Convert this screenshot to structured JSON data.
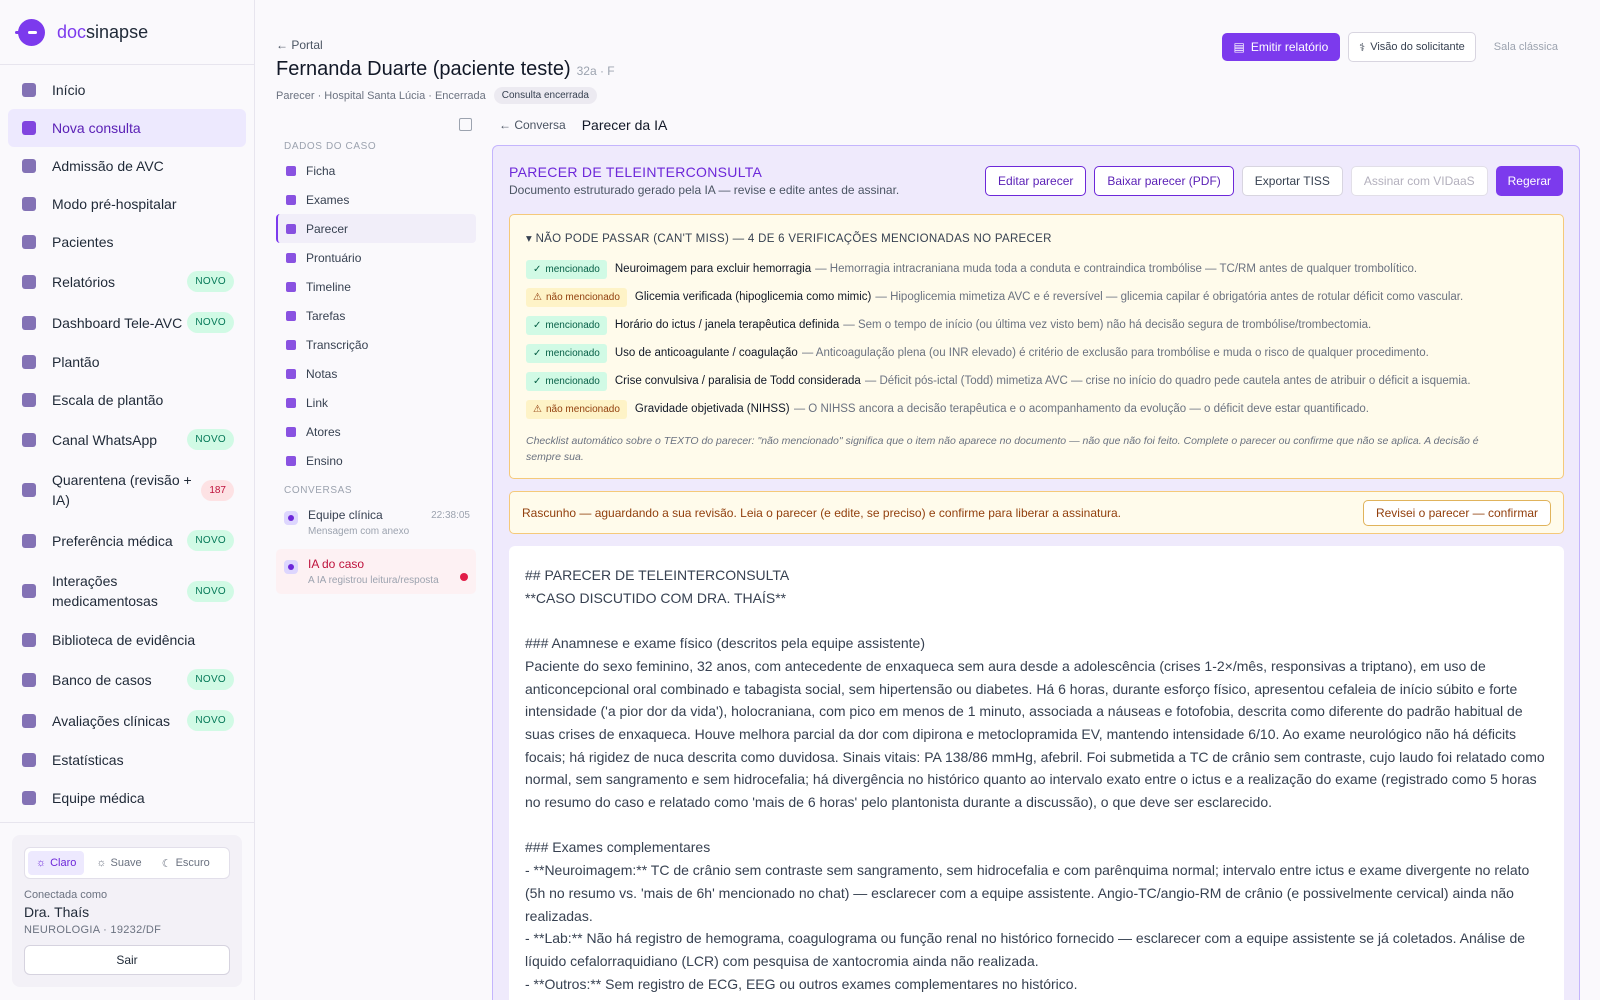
{
  "brand": {
    "prefix": "doc",
    "suffix": "sinapse"
  },
  "nav": [
    {
      "label": "Início",
      "icon": "home-icon"
    },
    {
      "label": "Nova consulta",
      "icon": "plus-icon",
      "active": true
    },
    {
      "label": "Admissão de AVC",
      "icon": "lock-icon"
    },
    {
      "label": "Modo pré-hospitalar",
      "icon": "ambulance-icon"
    },
    {
      "label": "Pacientes",
      "icon": "users-icon"
    },
    {
      "label": "Relatórios",
      "icon": "report-icon",
      "badge": "NOVO"
    },
    {
      "label": "Dashboard Tele-AVC",
      "icon": "chart-icon",
      "badge": "NOVO"
    },
    {
      "label": "Plantão",
      "icon": "shield-icon"
    },
    {
      "label": "Escala de plantão",
      "icon": "calendar-icon"
    },
    {
      "label": "Canal WhatsApp",
      "icon": "whatsapp-icon",
      "badge": "NOVO"
    },
    {
      "label": "Quarentena (revisão + IA)",
      "icon": "quarantine-icon",
      "count": "187"
    },
    {
      "label": "Preferência médica",
      "icon": "preference-icon",
      "badge": "NOVO"
    },
    {
      "label": "Interações medicamentosas",
      "icon": "pill-icon",
      "badge": "NOVO"
    },
    {
      "label": "Biblioteca de evidência",
      "icon": "book-icon"
    },
    {
      "label": "Banco de casos",
      "icon": "graduation-icon",
      "badge": "NOVO"
    },
    {
      "label": "Avaliações clínicas",
      "icon": "clipboard-icon",
      "badge": "NOVO"
    },
    {
      "label": "Estatísticas",
      "icon": "stats-icon"
    },
    {
      "label": "Equipe médica",
      "icon": "team-icon"
    }
  ],
  "theme": {
    "light": "Claro",
    "soft": "Suave",
    "dark": "Escuro"
  },
  "profile": {
    "connected_label": "Conectada como",
    "name": "Dra. Thaís",
    "role": "NEUROLOGIA · 19232/DF",
    "logout": "Sair"
  },
  "header": {
    "back": "← Portal",
    "patient_name": "Fernanda Duarte (paciente teste)",
    "patient_meta": "32a · F",
    "sub_meta": "Parecer · Hospital Santa Lúcia · Encerrada",
    "status_tag": "Consulta encerrada",
    "emit_report": "Emitir relatório",
    "requester_view": "Visão do solicitante",
    "classic_room": "Sala clássica"
  },
  "case_panel": {
    "section_label": "DADOS DO CASO",
    "items": [
      "Ficha",
      "Exames",
      "Parecer",
      "Prontuário",
      "Timeline",
      "Tarefas",
      "Transcrição",
      "Notas",
      "Link",
      "Atores",
      "Ensino"
    ],
    "active_index": 2,
    "conversations_label": "CONVERSAS",
    "conversations": [
      {
        "title": "Equipe clínica",
        "subtitle": "Mensagem com anexo",
        "time": "22:38:05"
      },
      {
        "title": "IA do caso",
        "subtitle": "A IA registrou leitura/resposta",
        "alert": true
      }
    ]
  },
  "breadcrumb": {
    "back": "← Conversa",
    "current": "Parecer da IA"
  },
  "opinion": {
    "title": "PARECER DE TELEINTERCONSULTA",
    "description": "Documento estruturado gerado pela IA — revise e edite antes de assinar.",
    "actions": {
      "edit": "Editar parecer",
      "download": "Baixar parecer (PDF)",
      "export": "Exportar TISS",
      "sign": "Assinar com VIDaaS",
      "regenerate": "Regerar"
    }
  },
  "checklist": {
    "header": "▾ NÃO PODE PASSAR (CAN'T MISS) — 4 DE 6 VERIFICAÇÕES MENCIONADAS NO PARECER",
    "ok_label": "mencionado",
    "warn_label": "não mencionado",
    "items": [
      {
        "status": "ok",
        "title": "Neuroimagem para excluir hemorragia",
        "desc": "— Hemorragia intracraniana muda toda a conduta e contraindica trombólise — TC/RM antes de qualquer trombolítico."
      },
      {
        "status": "warn",
        "title": "Glicemia verificada (hipoglicemia como mimic)",
        "desc": "— Hipoglicemia mimetiza AVC e é reversível — glicemia capilar é obrigatória antes de rotular déficit como vascular."
      },
      {
        "status": "ok",
        "title": "Horário do ictus / janela terapêutica definida",
        "desc": "— Sem o tempo de início (ou última vez visto bem) não há decisão segura de trombólise/trombectomia."
      },
      {
        "status": "ok",
        "title": "Uso de anticoagulante / coagulação",
        "desc": "— Anticoagulação plena (ou INR elevado) é critério de exclusão para trombólise e muda o risco de qualquer procedimento."
      },
      {
        "status": "ok",
        "title": "Crise convulsiva / paralisia de Todd considerada",
        "desc": "— Déficit pós-ictal (Todd) mimetiza AVC — crise no início do quadro pede cautela antes de atribuir o déficit a isquemia."
      },
      {
        "status": "warn",
        "title": "Gravidade objetivada (NIHSS)",
        "desc": "— O NIHSS ancora a decisão terapêutica e o acompanhamento da evolução — o déficit deve estar quantificado."
      }
    ],
    "note": "Checklist automático sobre o TEXTO do parecer: \"não mencionado\" significa que o item não aparece no documento — não que não foi feito. Complete o parecer ou confirme que não se aplica. A decisão é sempre sua."
  },
  "draft": {
    "text": "Rascunho — aguardando a sua revisão. Leia o parecer (e edite, se preciso) e confirme para liberar a assinatura.",
    "confirm": "Revisei o parecer — confirmar"
  },
  "document": {
    "h1": "## PARECER DE TELEINTERCONSULTA",
    "h1_sub": "**CASO DISCUTIDO COM DRA. THAÍS**",
    "s1_title": "### Anamnese e exame físico (descritos pela equipe assistente)",
    "s1_body": "Paciente do sexo feminino, 32 anos, com antecedente de enxaqueca sem aura desde a adolescência (crises 1-2×/mês, responsivas a triptano), em uso de anticoncepcional oral combinado e tabagista social, sem hipertensão ou diabetes. Há 6 horas, durante esforço físico, apresentou cefaleia de início súbito e forte intensidade ('a pior dor da vida'), holocraniana, com pico em menos de 1 minuto, associada a náuseas e fotofobia, descrita como diferente do padrão habitual de suas crises de enxaqueca. Houve melhora parcial da dor com dipirona e metoclopramida EV, mantendo intensidade 6/10. Ao exame neurológico não há déficits focais; há rigidez de nuca descrita como duvidosa. Sinais vitais: PA 138/86 mmHg, afebril. Foi submetida a TC de crânio sem contraste, cujo laudo foi relatado como normal, sem sangramento e sem hidrocefalia; há divergência no histórico quanto ao intervalo exato entre o ictus e a realização do exame (registrado como 5 horas no resumo do caso e relatado como 'mais de 6 horas' pelo plantonista durante a discussão), o que deve ser esclarecido.",
    "s2_title": "### Exames complementares",
    "s2_items": [
      "- **Neuroimagem:** TC de crânio sem contraste sem sangramento, sem hidrocefalia e com parênquima normal; intervalo entre ictus e exame divergente no relato (5h no resumo vs. 'mais de 6h' mencionado no chat) — esclarecer com a equipe assistente. Angio-TC/angio-RM de crânio (e possivelmente cervical) ainda não realizadas.",
      "- **Lab:** Não há registro de hemograma, coagulograma ou função renal no histórico fornecido — esclarecer com a equipe assistente se já coletados. Análise de líquido cefalorraquidiano (LCR) com pesquisa de xantocromia ainda não realizada.",
      "- **Outros:** Sem registro de ECG, EEG ou outros exames complementares no histórico."
    ]
  }
}
